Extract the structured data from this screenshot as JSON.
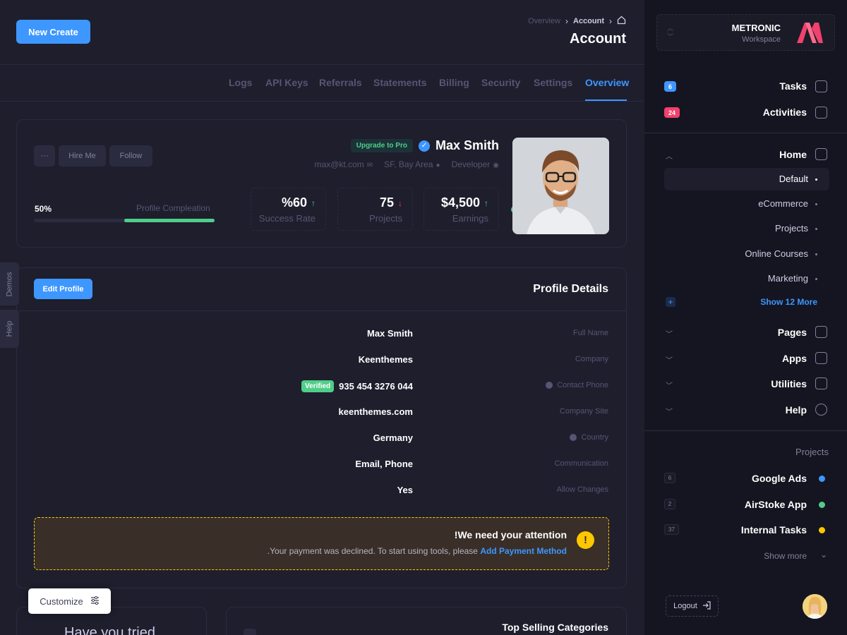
{
  "header": {
    "new_button": "New Create",
    "breadcrumb": [
      "Overview",
      "Account"
    ],
    "title": "Account"
  },
  "tabs": [
    "Logs",
    "API Keys",
    "Referrals",
    "Statements",
    "Billing",
    "Security",
    "Settings",
    "Overview"
  ],
  "profile": {
    "more_button": "···",
    "hire_button": "Hire Me",
    "follow_button": "Follow",
    "upgrade_badge": "Upgrade to Pro",
    "name": "Max Smith",
    "email": "max@kt.com",
    "location": "SF, Bay Area",
    "role": "Developer",
    "progress_value": "50%",
    "progress_fraction": 0.5,
    "progress_label": "Profile Compleation",
    "stats": [
      {
        "value": "%60",
        "label": "Success Rate",
        "trend": "up"
      },
      {
        "value": "75",
        "label": "Projects",
        "trend": "down"
      },
      {
        "value": "$4,500",
        "label": "Earnings",
        "trend": "up"
      }
    ]
  },
  "details": {
    "edit_button": "Edit Profile",
    "title": "Profile Details",
    "rows": [
      {
        "label": "Full Name",
        "value": "Max Smith"
      },
      {
        "label": "Company",
        "value": "Keenthemes"
      },
      {
        "label": "Contact Phone",
        "value": "935 454 3276 044",
        "badge": "Verified"
      },
      {
        "label": "Company Site",
        "value": "keenthemes.com"
      },
      {
        "label": "Country",
        "value": "Germany"
      },
      {
        "label": "Communication",
        "value": "Email, Phone"
      },
      {
        "label": "Allow Changes",
        "value": "Yes"
      }
    ],
    "notice_title": "!We need your attention",
    "notice_text": ".Your payment was declined. To start using tools, please",
    "notice_link": "Add Payment Method"
  },
  "bottom": {
    "left_title": "Have you tried",
    "right_title": "Top Selling Categories",
    "customize_button": "Customize"
  },
  "side_tabs": {
    "demos": "Demos",
    "help": "Help"
  },
  "sidebar": {
    "workspace_name": "METRONIC",
    "workspace_sub": "Workspace",
    "top_items": [
      {
        "label": "Tasks",
        "badge": "6",
        "badge_color": "#3e97ff"
      },
      {
        "label": "Activities",
        "badge": "24",
        "badge_color": "#f1416c"
      }
    ],
    "home_label": "Home",
    "home_sub": [
      "Default",
      "eCommerce",
      "Projects",
      "Online Courses",
      "Marketing"
    ],
    "show_more_link": "Show 12 More",
    "menu": [
      "Pages",
      "Apps",
      "Utilities",
      "Help"
    ],
    "projects_title": "Projects",
    "projects": [
      {
        "label": "Google Ads",
        "count": "6",
        "color": "#3e97ff"
      },
      {
        "label": "AirStoke App",
        "count": "2",
        "color": "#50cd89"
      },
      {
        "label": "Internal Tasks",
        "count": "37",
        "color": "#ffc700"
      }
    ],
    "show_more": "Show more",
    "logout": "Logout"
  }
}
